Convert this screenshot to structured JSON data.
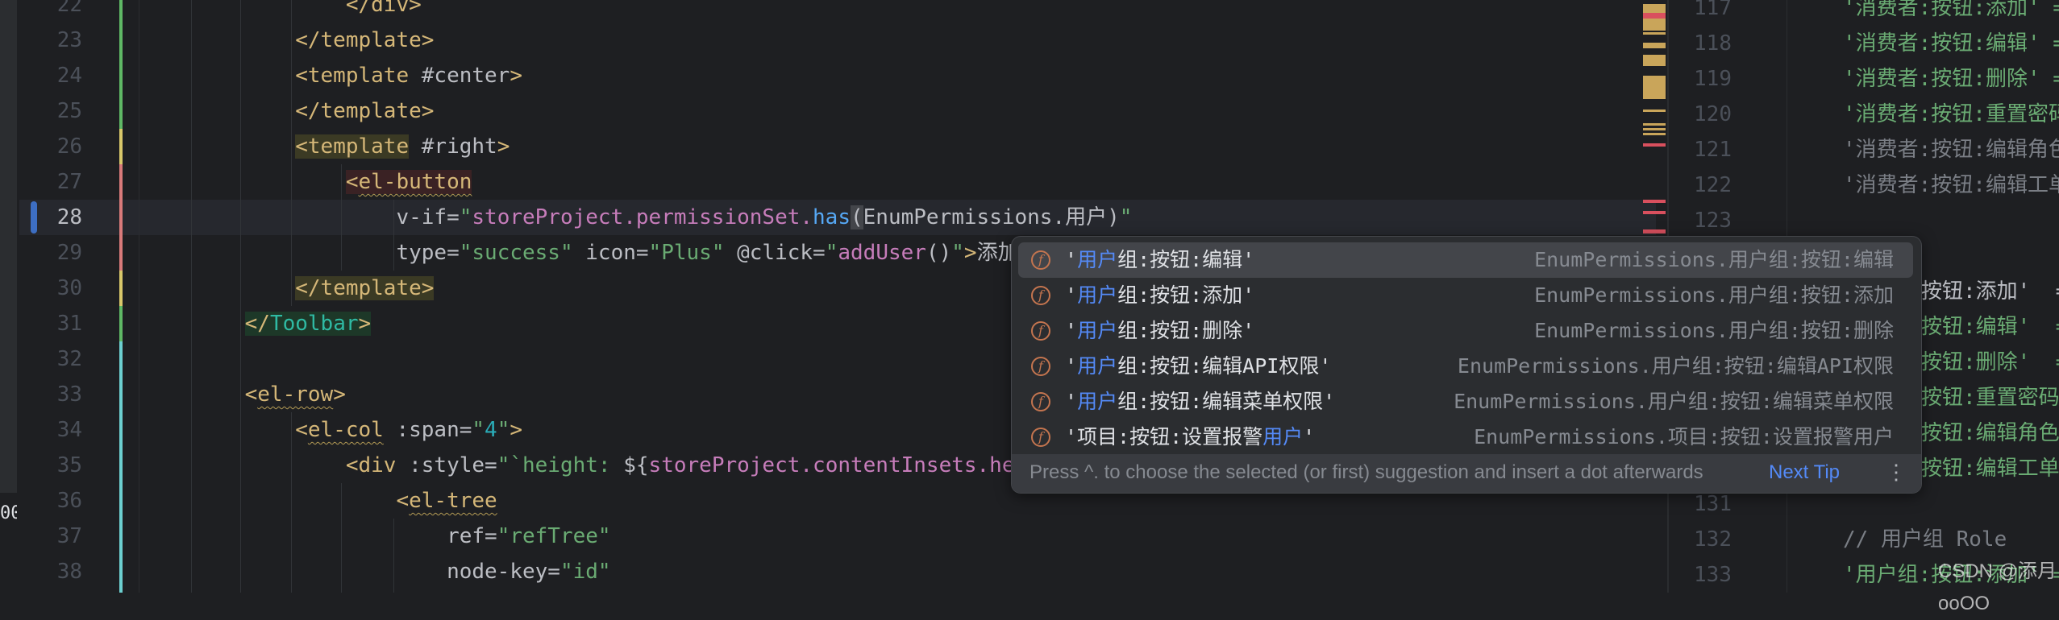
{
  "editor": {
    "current_line": 28,
    "left_strip_glyph": "00",
    "lines": [
      {
        "n": 22,
        "tokens": [
          [
            "            </div>",
            "tag"
          ]
        ]
      },
      {
        "n": 23,
        "tokens": [
          [
            "        </template>",
            "tag"
          ]
        ]
      },
      {
        "n": 24,
        "tokens": [
          [
            "        <template",
            "tag"
          ],
          [
            " #center",
            "attr"
          ],
          [
            ">",
            "tag"
          ]
        ]
      },
      {
        "n": 25,
        "tokens": [
          [
            "        </template>",
            "tag"
          ]
        ]
      },
      {
        "n": 26,
        "tokens": [
          [
            "        ",
            "txt"
          ],
          [
            "<template",
            "tag",
            "olive"
          ],
          [
            " #right",
            "attr"
          ],
          [
            ">",
            "tag"
          ]
        ]
      },
      {
        "n": 27,
        "tokens": [
          [
            "            ",
            "txt"
          ],
          [
            "<",
            "tag",
            "red"
          ],
          [
            "el-button",
            "tag",
            "red wavy"
          ]
        ]
      },
      {
        "n": 28,
        "tokens": [
          [
            "                v-if=",
            "attr"
          ],
          [
            "\"",
            "str"
          ],
          [
            "storeProject.permissionSet.",
            "pink"
          ],
          [
            "has",
            "fn"
          ],
          [
            "(",
            "txt",
            "brace"
          ],
          [
            "EnumPermissions.用户)",
            "txt"
          ],
          [
            "\"",
            "str"
          ]
        ]
      },
      {
        "n": 29,
        "tokens": [
          [
            "                type=",
            "attr"
          ],
          [
            "\"success\"",
            "str"
          ],
          [
            " icon=",
            "attr"
          ],
          [
            "\"Plus\"",
            "str"
          ],
          [
            " @click=",
            "attr"
          ],
          [
            "\"",
            "str"
          ],
          [
            "addUser",
            "pink"
          ],
          [
            "()",
            "txt"
          ],
          [
            "\"",
            "str"
          ],
          [
            ">",
            "tag"
          ],
          [
            "添加",
            "txt"
          ]
        ]
      },
      {
        "n": 30,
        "tokens": [
          [
            "        ",
            "txt"
          ],
          [
            "</template>",
            "tag",
            "olive"
          ]
        ]
      },
      {
        "n": 31,
        "tokens": [
          [
            "    ",
            "txt"
          ],
          [
            "</",
            "tag",
            "green"
          ],
          [
            "Toolbar",
            "teal",
            "green"
          ],
          [
            ">",
            "tag",
            "green"
          ]
        ]
      },
      {
        "n": 32,
        "tokens": []
      },
      {
        "n": 33,
        "tokens": [
          [
            "    <",
            "tag"
          ],
          [
            "el-row",
            "tag",
            "wavy"
          ],
          [
            ">",
            "tag"
          ]
        ]
      },
      {
        "n": 34,
        "tokens": [
          [
            "        <",
            "tag"
          ],
          [
            "el-col",
            "tag",
            "wavy"
          ],
          [
            " :span=",
            "attr"
          ],
          [
            "\"",
            "str"
          ],
          [
            "4",
            "num"
          ],
          [
            "\"",
            "str"
          ],
          [
            ">",
            "tag"
          ]
        ]
      },
      {
        "n": 35,
        "tokens": [
          [
            "            <div",
            "tag"
          ],
          [
            " :style=",
            "attr"
          ],
          [
            "\"`height: ",
            "str"
          ],
          [
            "${",
            "txt"
          ],
          [
            "storeProject.contentInsets.he",
            "pink"
          ]
        ]
      },
      {
        "n": 36,
        "tokens": [
          [
            "                <",
            "tag"
          ],
          [
            "el-tree",
            "tag",
            "wavy"
          ]
        ]
      },
      {
        "n": 37,
        "tokens": [
          [
            "                    ref=",
            "attr"
          ],
          [
            "\"refTree\"",
            "str"
          ]
        ]
      },
      {
        "n": 38,
        "tokens": [
          [
            "                    node-key=",
            "attr"
          ],
          [
            "\"id\"",
            "str"
          ]
        ]
      }
    ],
    "right_pane": {
      "lines": [
        {
          "n": 117,
          "text": "'消费者:按钮:添加' =",
          "kind": "str"
        },
        {
          "n": 118,
          "text": "'消费者:按钮:编辑' =",
          "kind": "str"
        },
        {
          "n": 119,
          "text": "'消费者:按钮:删除' =",
          "kind": "str"
        },
        {
          "n": 120,
          "text": "'消费者:按钮:重置密码",
          "kind": "str"
        },
        {
          "n": 121,
          "text": "'消费者:按钮:编辑角色",
          "kind": "gray"
        },
        {
          "n": 122,
          "text": "'消费者:按钮:编辑工单",
          "kind": "gray"
        },
        {
          "n": 123,
          "text": "",
          "kind": "str"
        },
        {
          "n": 131,
          "text": "",
          "kind": "str"
        },
        {
          "n": 132,
          "text": "// 用户组 Role",
          "kind": "cmt"
        },
        {
          "n": 133,
          "text": "'用户组:按钮:添加' =",
          "kind": "str"
        }
      ],
      "partial_lines": [
        {
          "row": 125,
          "text": "按钮:添加'  =",
          "kind": "txt"
        },
        {
          "row": 126,
          "text": "按钮:编辑'  =",
          "kind": "str"
        },
        {
          "row": 127,
          "text": "按钮:删除'  =",
          "kind": "str"
        },
        {
          "row": 128,
          "text": "按钮:重置密码'",
          "kind": "str"
        },
        {
          "row": 129,
          "text": "按钮:编辑角色'",
          "kind": "str"
        },
        {
          "row": 130,
          "text": "按钮:编辑工单标",
          "kind": "str"
        }
      ]
    }
  },
  "completion_popup": {
    "selected_index": 0,
    "item_icon": "f",
    "items": [
      {
        "pre": "'",
        "match": "用户",
        "post": "组:按钮:编辑'",
        "type": "EnumPermissions.用户组:按钮:编辑"
      },
      {
        "pre": "'",
        "match": "用户",
        "post": "组:按钮:添加'",
        "type": "EnumPermissions.用户组:按钮:添加"
      },
      {
        "pre": "'",
        "match": "用户",
        "post": "组:按钮:删除'",
        "type": "EnumPermissions.用户组:按钮:删除"
      },
      {
        "pre": "'",
        "match": "用户",
        "post": "组:按钮:编辑API权限'",
        "type": "EnumPermissions.用户组:按钮:编辑API权限"
      },
      {
        "pre": "'",
        "match": "用户",
        "post": "组:按钮:编辑菜单权限'",
        "type": "EnumPermissions.用户组:按钮:编辑菜单权限"
      },
      {
        "pre": "'项目:按钮:设置报警",
        "match": "用户",
        "post": "'",
        "type": "EnumPermissions.项目:按钮:设置报警用户"
      }
    ],
    "footer_text": "Press ^. to choose the selected (or first) suggestion and insert a dot afterwards",
    "next_tip_label": "Next Tip",
    "more_icon": "⋮"
  },
  "watermark": "CSDN @添月ooOO",
  "colors": {
    "accent": "#548af7",
    "tag": "#d5b778",
    "string": "#6aab73",
    "background": "#1e1f22"
  }
}
